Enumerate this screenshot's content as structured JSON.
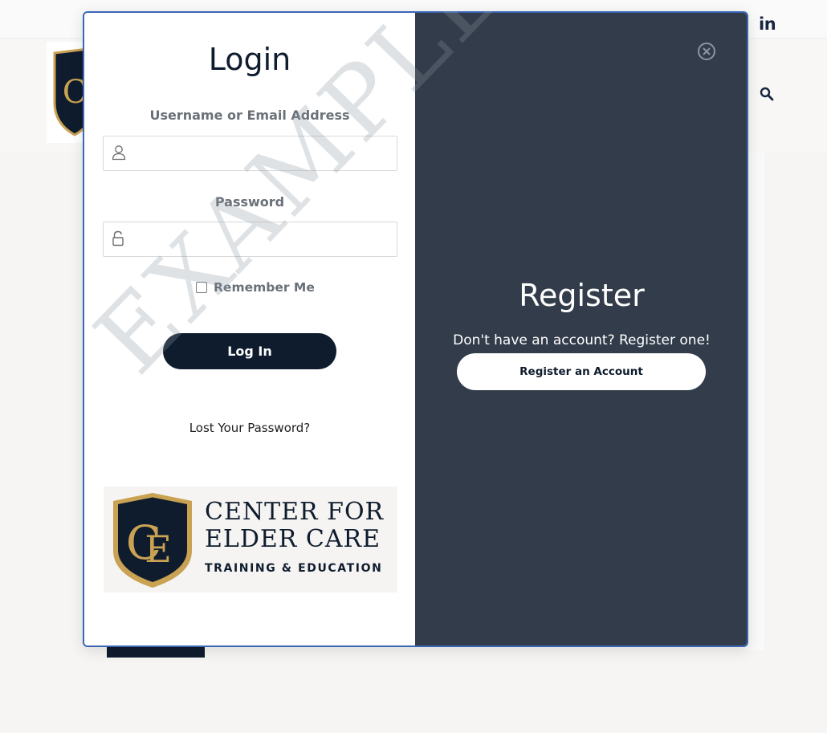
{
  "background": {
    "social": {
      "linkedin_label": "in"
    },
    "header": {
      "search_icon": "search-icon",
      "logo_letters": "CE"
    }
  },
  "login": {
    "title": "Login",
    "username_label": "Username or Email Address",
    "username_value": "",
    "username_icon": "user-icon",
    "password_label": "Password",
    "password_value": "",
    "password_icon": "lock-icon",
    "remember_label": "Remember Me",
    "remember_checked": false,
    "submit_label": "Log In",
    "lost_password_label": "Lost Your Password?"
  },
  "brand": {
    "logo_letters": "CE",
    "line1": "CENTER FOR",
    "line2": "ELDER CARE",
    "line3": "TRAINING & EDUCATION"
  },
  "register": {
    "title": "Register",
    "subtitle": "Don't have an account? Register one!",
    "button_label": "Register an Account",
    "close_icon": "close-icon"
  },
  "watermark": "EXAMPLE",
  "colors": {
    "navy": "#0f1c2e",
    "panel": "#323c4a",
    "gold": "#c9a253",
    "modal_border": "#3a66b4"
  }
}
